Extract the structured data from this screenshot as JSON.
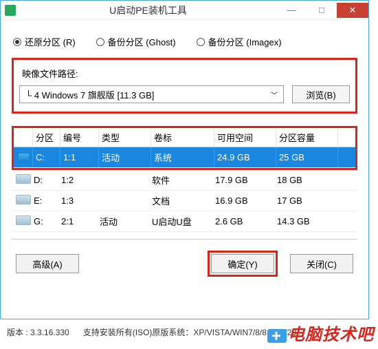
{
  "window": {
    "title": "U启动PE装机工具"
  },
  "radios": {
    "restore": "还原分区 (R)",
    "backup_ghost": "备份分区 (Ghost)",
    "backup_imagex": "备份分区 (Imagex)"
  },
  "path": {
    "label": "映像文件路径:",
    "selected": "└ 4 Windows 7 旗舰版 [11.3 GB]",
    "browse": "浏览(B)"
  },
  "table": {
    "headers": {
      "drive": "分区",
      "index": "编号",
      "type": "类型",
      "label": "卷标",
      "free": "可用空间",
      "capacity": "分区容量"
    },
    "rows": [
      {
        "drive": "C:",
        "index": "1:1",
        "type": "活动",
        "label": "系统",
        "free": "24.9 GB",
        "capacity": "25 GB",
        "selected": true
      },
      {
        "drive": "D:",
        "index": "1:2",
        "type": "",
        "label": "软件",
        "free": "17.9 GB",
        "capacity": "18 GB",
        "selected": false
      },
      {
        "drive": "E:",
        "index": "1:3",
        "type": "",
        "label": "文档",
        "free": "16.9 GB",
        "capacity": "17 GB",
        "selected": false
      },
      {
        "drive": "G:",
        "index": "2:1",
        "type": "活动",
        "label": "U启动U盘",
        "free": "2.6 GB",
        "capacity": "14.3 GB",
        "selected": false
      }
    ]
  },
  "buttons": {
    "advanced": "高级(A)",
    "ok": "确定(Y)",
    "close": "关闭(C)"
  },
  "footer": {
    "version_label": "版本 : 3.3.16.330",
    "support": "支持安装所有(ISO)原版系统：XP/VISTA/WIN7/8/8.1/10/20"
  },
  "watermark": "电脑技术吧"
}
